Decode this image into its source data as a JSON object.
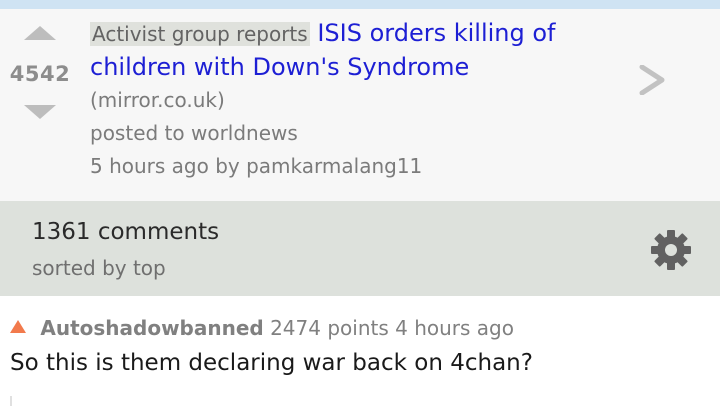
{
  "post": {
    "score": "4542",
    "flair": "Activist group reports",
    "title": "ISIS orders killing of children with Down's Syndrome",
    "domain": "(mirror.co.uk)",
    "posted_to": "posted to worldnews",
    "age": "5 hours ago",
    "by_prefix": "by",
    "author": "pamkarmalang11"
  },
  "comments_header": {
    "count": "1361 comments",
    "sort": "sorted by top"
  },
  "comment": {
    "author": "Autoshadowbanned",
    "points": "2474 points",
    "age": "4 hours ago",
    "text": "So this is them declaring war back on 4chan?"
  },
  "colors": {
    "title_link": "#1d1fd4",
    "upvote_accent": "#f27a4c",
    "comments_bar": "#dde1dc"
  }
}
